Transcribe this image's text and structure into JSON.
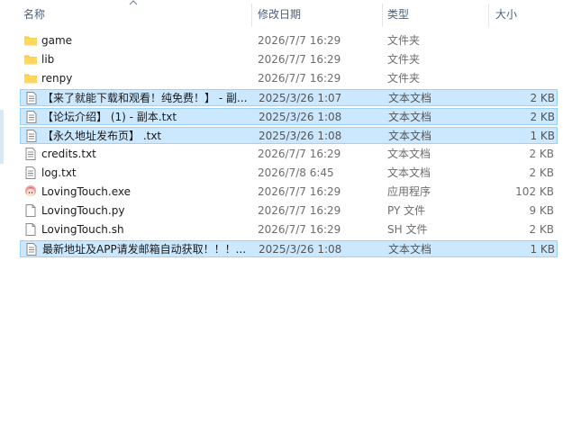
{
  "columns": {
    "name": "名称",
    "modified": "修改日期",
    "type": "类型",
    "size": "大小"
  },
  "files": [
    {
      "name": "game",
      "date": "2026/7/7 16:29",
      "type": "文件夹",
      "size": "",
      "icon": "folder-icon",
      "selected": false
    },
    {
      "name": "lib",
      "date": "2026/7/7 16:29",
      "type": "文件夹",
      "size": "",
      "icon": "folder-icon",
      "selected": false
    },
    {
      "name": "renpy",
      "date": "2026/7/7 16:29",
      "type": "文件夹",
      "size": "",
      "icon": "folder-icon",
      "selected": false
    },
    {
      "name": "【来了就能下载和观看！纯免费！】 - 副...",
      "date": "2025/3/26 1:07",
      "type": "文本文档",
      "size": "2 KB",
      "icon": "text-file-icon",
      "selected": true
    },
    {
      "name": "【论坛介绍】 (1) - 副本.txt",
      "date": "2025/3/26 1:08",
      "type": "文本文档",
      "size": "2 KB",
      "icon": "text-file-icon",
      "selected": true
    },
    {
      "name": "【永久地址发布页】 .txt",
      "date": "2025/3/26 1:08",
      "type": "文本文档",
      "size": "1 KB",
      "icon": "text-file-icon",
      "selected": true
    },
    {
      "name": "credits.txt",
      "date": "2026/7/7 16:29",
      "type": "文本文档",
      "size": "2 KB",
      "icon": "text-file-icon",
      "selected": false
    },
    {
      "name": "log.txt",
      "date": "2026/7/8 6:45",
      "type": "文本文档",
      "size": "2 KB",
      "icon": "text-file-icon",
      "selected": false
    },
    {
      "name": "LovingTouch.exe",
      "date": "2026/7/7 16:29",
      "type": "应用程序",
      "size": "102 KB",
      "icon": "app-character-icon",
      "selected": false
    },
    {
      "name": "LovingTouch.py",
      "date": "2026/7/7 16:29",
      "type": "PY 文件",
      "size": "9 KB",
      "icon": "blank-file-icon",
      "selected": false
    },
    {
      "name": "LovingTouch.sh",
      "date": "2026/7/7 16:29",
      "type": "SH 文件",
      "size": "2 KB",
      "icon": "blank-file-icon",
      "selected": false
    },
    {
      "name": "最新地址及APP请发邮箱自动获取！！！...",
      "date": "2025/3/26 1:08",
      "type": "文本文档",
      "size": "1 KB",
      "icon": "text-file-icon",
      "selected": true
    }
  ],
  "colors": {
    "selection_bg": "#cce8ff",
    "selection_border": "#99d1ff",
    "header_text": "#4c607a",
    "folder": "#ffd75e"
  }
}
